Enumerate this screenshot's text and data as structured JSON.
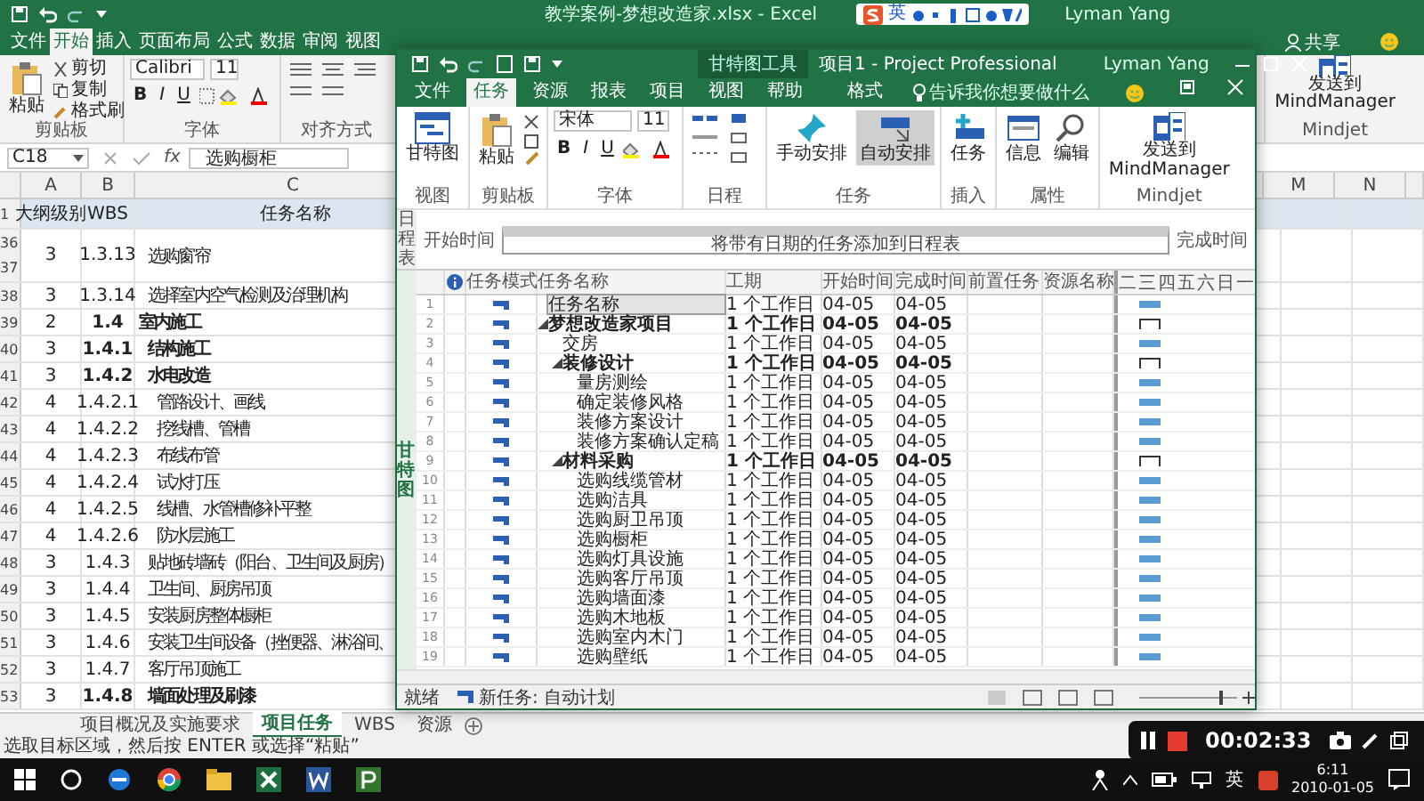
{
  "excel": {
    "title": "教学案例-梦想改造家.xlsx - Excel",
    "ime_mode": "英",
    "user": "Lyman Yang",
    "tabs": [
      {
        "label": "文件",
        "selected": false
      },
      {
        "label": "开始",
        "selected": true
      },
      {
        "label": "插入",
        "selected": false
      },
      {
        "label": "页面布局",
        "selected": false
      },
      {
        "label": "公式",
        "selected": false
      },
      {
        "label": "数据",
        "selected": false
      },
      {
        "label": "审阅",
        "selected": false
      },
      {
        "label": "视图",
        "selected": false
      }
    ],
    "share": "共享",
    "ribbon": {
      "paste": "粘贴",
      "cut": "剪切",
      "copy": "复制",
      "format_painter": "格式刷",
      "font": "Calibri",
      "size": "11",
      "format_buttons": [
        "B",
        "I",
        "U"
      ],
      "groups": [
        "剪贴板",
        "字体",
        "对齐方式"
      ],
      "send_label": "发送到",
      "send_target": "MindManager",
      "send_group": "Mindjet"
    },
    "name_box": "C18",
    "function_label": "fx",
    "formula": "选购橱柜",
    "header_row": "1",
    "columns": [
      "A",
      "B",
      "C"
    ],
    "right_columns": [
      "M",
      "N"
    ],
    "header": [
      "大纲级别",
      "WBS",
      "任务名称"
    ],
    "rows": [
      {
        "numbers": [
          "36",
          "37"
        ],
        "level": "3",
        "wbs": "1.3.13",
        "name": "选购窗帘",
        "bold": false
      },
      {
        "numbers": [
          "38"
        ],
        "level": "3",
        "wbs": "1.3.14",
        "name": "选择室内空气检测及治理机构",
        "bold": false
      },
      {
        "numbers": [
          "39"
        ],
        "level": "2",
        "wbs": "1.4",
        "name": "室内施工",
        "bold": true
      },
      {
        "numbers": [
          "40"
        ],
        "level": "3",
        "wbs": "1.4.1",
        "name": "结构施工",
        "bold": true
      },
      {
        "numbers": [
          "41"
        ],
        "level": "3",
        "wbs": "1.4.2",
        "name": "水电改造",
        "bold": true
      },
      {
        "numbers": [
          "42"
        ],
        "level": "4",
        "wbs": "1.4.2.1",
        "name": "管路设计、画线",
        "bold": false
      },
      {
        "numbers": [
          "43"
        ],
        "level": "4",
        "wbs": "1.4.2.2",
        "name": "挖线槽、管槽",
        "bold": false
      },
      {
        "numbers": [
          "44"
        ],
        "level": "4",
        "wbs": "1.4.2.3",
        "name": "布线布管",
        "bold": false
      },
      {
        "numbers": [
          "45"
        ],
        "level": "4",
        "wbs": "1.4.2.4",
        "name": "试水打压",
        "bold": false
      },
      {
        "numbers": [
          "46"
        ],
        "level": "4",
        "wbs": "1.4.2.5",
        "name": "线槽、水管槽修补平整",
        "bold": false
      },
      {
        "numbers": [
          "47"
        ],
        "level": "4",
        "wbs": "1.4.2.6",
        "name": "防水层施工",
        "bold": false
      },
      {
        "numbers": [
          "48"
        ],
        "level": "3",
        "wbs": "1.4.3",
        "name": "贴地砖墙砖（阳台、卫生间及厨房）",
        "bold": false
      },
      {
        "numbers": [
          "49"
        ],
        "level": "3",
        "wbs": "1.4.4",
        "name": "卫生间、厨房吊顶",
        "bold": false
      },
      {
        "numbers": [
          "50"
        ],
        "level": "3",
        "wbs": "1.4.5",
        "name": "安装厨房整体橱柜",
        "bold": false
      },
      {
        "numbers": [
          "51"
        ],
        "level": "3",
        "wbs": "1.4.6",
        "name": "安装卫生间设备（挫便器、淋浴间、",
        "bold": false
      },
      {
        "numbers": [
          "52"
        ],
        "level": "3",
        "wbs": "1.4.7",
        "name": "客厅吊顶施工",
        "bold": false
      },
      {
        "numbers": [
          "53"
        ],
        "level": "3",
        "wbs": "1.4.8",
        "name": "墙面处理及刷漆",
        "bold": true
      }
    ],
    "sheets": [
      {
        "label": "项目概况及实施要求",
        "selected": false
      },
      {
        "label": "项目任务",
        "selected": true
      },
      {
        "label": "WBS",
        "selected": false
      },
      {
        "label": "资源",
        "selected": false
      }
    ],
    "status": "选取目标区域，然后按 ENTER 或选择“粘贴”"
  },
  "project": {
    "context_tab": "甘特图工具",
    "title": "项目1 - Project Professional",
    "user": "Lyman Yang",
    "tabs": [
      {
        "label": "文件",
        "selected": false
      },
      {
        "label": "任务",
        "selected": true
      },
      {
        "label": "资源",
        "selected": false
      },
      {
        "label": "报表",
        "selected": false
      },
      {
        "label": "项目",
        "selected": false
      },
      {
        "label": "视图",
        "selected": false
      },
      {
        "label": "帮助",
        "selected": false
      },
      {
        "label": "格式",
        "selected": false
      }
    ],
    "search": "告诉我你想要做什么",
    "ribbon": [
      {
        "label": "视图",
        "items": [
          {
            "kind": "gantt",
            "label": "甘特图",
            "selected": false
          }
        ]
      },
      {
        "label": "剪贴板",
        "items": [
          {
            "kind": "paste",
            "label": "粘贴",
            "selected": false
          }
        ]
      },
      {
        "label": "字体",
        "items": [
          {
            "kind": "font",
            "font": "宋体",
            "size": "11",
            "format_buttons": [
              "B",
              "I",
              "U"
            ]
          }
        ]
      },
      {
        "label": "日程",
        "items": [
          {
            "kind": "schedule"
          }
        ]
      },
      {
        "label": "任务",
        "items": [
          {
            "kind": "pin",
            "label": "手动安排",
            "selected": false
          },
          {
            "kind": "auto",
            "label": "自动安排",
            "selected": true
          }
        ]
      },
      {
        "label": "插入",
        "items": [
          {
            "kind": "insert",
            "label": "任务",
            "selected": false
          }
        ]
      },
      {
        "label": "属性",
        "items": [
          {
            "kind": "info",
            "label": "信息",
            "selected": false
          },
          {
            "kind": "edit",
            "label": "编辑",
            "selected": false
          }
        ]
      },
      {
        "label": "Mindjet",
        "items": [
          {
            "kind": "mind",
            "label": "发送到",
            "sublabel": "MindManager",
            "selected": false
          }
        ]
      }
    ],
    "timeline": {
      "side_label": "日程表",
      "start_label": "开始时间",
      "banner": "将带有日期的任务添加到日程表",
      "finish_label": "完成时间"
    },
    "view_label": "甘特图",
    "columns": [
      "任务模式",
      "任务名称",
      "工期",
      "开始时间",
      "完成时间",
      "前置任务",
      "资源名称"
    ],
    "days": [
      "二",
      "三",
      "四",
      "五",
      "六",
      "日",
      "一"
    ],
    "tasks": [
      {
        "id": "1",
        "name": "任务名称",
        "duration": "1 个工作日",
        "start": "04-05",
        "finish": "04-05",
        "selected": true
      },
      {
        "id": "2",
        "name": "梦想改造家项目",
        "duration": "1 个工作日",
        "start": "04-05",
        "finish": "04-05",
        "selected": false,
        "children": [
          {
            "id": "3",
            "name": "交房",
            "duration": "1 个工作日",
            "start": "04-05",
            "finish": "04-05",
            "selected": false
          },
          {
            "id": "4",
            "name": "装修设计",
            "duration": "1 个工作日",
            "start": "04-05",
            "finish": "04-05",
            "selected": false,
            "children": [
              {
                "id": "5",
                "name": "量房测绘",
                "duration": "1 个工作日",
                "start": "04-05",
                "finish": "04-05",
                "selected": false
              },
              {
                "id": "6",
                "name": "确定装修风格",
                "duration": "1 个工作日",
                "start": "04-05",
                "finish": "04-05",
                "selected": false
              },
              {
                "id": "7",
                "name": "装修方案设计",
                "duration": "1 个工作日",
                "start": "04-05",
                "finish": "04-05",
                "selected": false
              },
              {
                "id": "8",
                "name": "装修方案确认定稿",
                "duration": "1 个工作日",
                "start": "04-05",
                "finish": "04-05",
                "selected": false
              }
            ]
          },
          {
            "id": "9",
            "name": "材料采购",
            "duration": "1 个工作日",
            "start": "04-05",
            "finish": "04-05",
            "selected": false,
            "children": [
              {
                "id": "10",
                "name": "选购线缆管材",
                "duration": "1 个工作日",
                "start": "04-05",
                "finish": "04-05",
                "selected": false
              },
              {
                "id": "11",
                "name": "选购洁具",
                "duration": "1 个工作日",
                "start": "04-05",
                "finish": "04-05",
                "selected": false
              },
              {
                "id": "12",
                "name": "选购厨卫吊顶",
                "duration": "1 个工作日",
                "start": "04-05",
                "finish": "04-05",
                "selected": false
              },
              {
                "id": "13",
                "name": "选购橱柜",
                "duration": "1 个工作日",
                "start": "04-05",
                "finish": "04-05",
                "selected": false
              },
              {
                "id": "14",
                "name": "选购灯具设施",
                "duration": "1 个工作日",
                "start": "04-05",
                "finish": "04-05",
                "selected": false
              },
              {
                "id": "15",
                "name": "选购客厅吊顶",
                "duration": "1 个工作日",
                "start": "04-05",
                "finish": "04-05",
                "selected": false
              },
              {
                "id": "16",
                "name": "选购墙面漆",
                "duration": "1 个工作日",
                "start": "04-05",
                "finish": "04-05",
                "selected": false
              },
              {
                "id": "17",
                "name": "选购木地板",
                "duration": "1 个工作日",
                "start": "04-05",
                "finish": "04-05",
                "selected": false
              },
              {
                "id": "18",
                "name": "选购室内木门",
                "duration": "1 个工作日",
                "start": "04-05",
                "finish": "04-05",
                "selected": false
              },
              {
                "id": "19",
                "name": "选购壁纸",
                "duration": "1 个工作日",
                "start": "04-05",
                "finish": "04-05",
                "selected": false
              }
            ]
          }
        ]
      }
    ],
    "status": "就绪",
    "new_task": "新任务: 自动计划"
  },
  "recorder": {
    "time": "00:02:33"
  },
  "taskbar": {
    "ime": "英",
    "time": "6:11",
    "date": "2010-01-05"
  }
}
